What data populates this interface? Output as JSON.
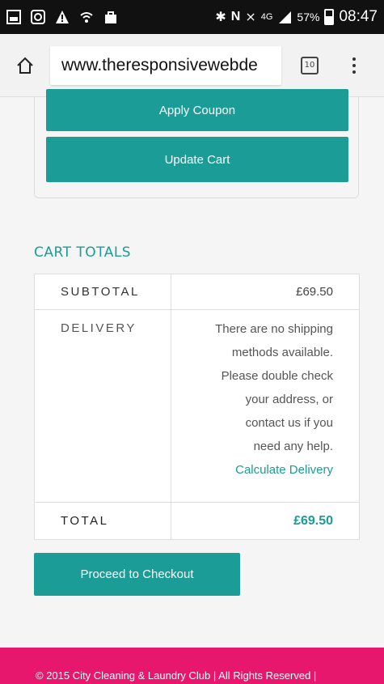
{
  "status_bar": {
    "network": "4G",
    "battery": "57%",
    "time": "08:47"
  },
  "browser": {
    "url": "www.theresponsivewebde",
    "tab_count": "10"
  },
  "coupon": {
    "apply_label": "Apply Coupon",
    "update_label": "Update Cart"
  },
  "cart_totals": {
    "title": "CART TOTALS",
    "subtotal_label": "SUBTOTAL",
    "subtotal_value": "£69.50",
    "delivery_label": "DELIVERY",
    "delivery_lines": [
      "There are no shipping",
      "methods available.",
      "Please double check",
      "your address, or",
      "contact us if you",
      "need any help."
    ],
    "calculate_delivery": "Calculate Delivery",
    "total_label": "TOTAL",
    "total_value": "£69.50"
  },
  "checkout": {
    "label": "Proceed to Checkout"
  },
  "footer": {
    "text": "© 2015 City Cleaning & Laundry Club | All Rights Reserved |"
  },
  "colors": {
    "accent": "#1b9c96",
    "footer_bg": "#e6176c",
    "status_bar_bg": "#111111"
  }
}
